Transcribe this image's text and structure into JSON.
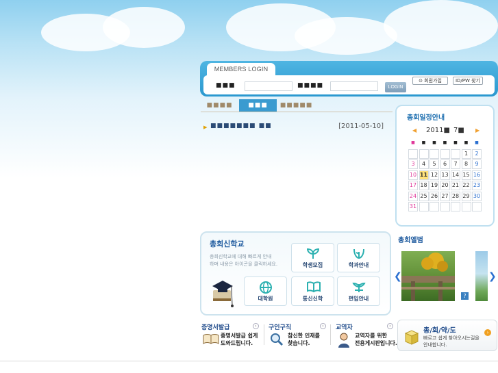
{
  "login": {
    "tab_label": "MEMBERS LOGIN",
    "id_label": "■■■",
    "pw_label": "■■■■",
    "id_value": "",
    "pw_value": "",
    "login_button": "LOGIN",
    "join_button": "회원가입",
    "find_button": "ID/PW 찾기"
  },
  "tabs": [
    {
      "label": "■■■■",
      "active": false
    },
    {
      "label": "■■■",
      "active": true
    },
    {
      "label": "■■■■■",
      "active": false
    }
  ],
  "notice": {
    "title": "■■■■■■■ ■■",
    "date": "[2011-05-10]"
  },
  "calendar": {
    "title": "총회일정안내",
    "year": "2011",
    "year_suffix": "■",
    "month": "7",
    "month_suffix": "■",
    "prev": "◀",
    "next": "▶",
    "weekday_headers": [
      "■",
      "■",
      "■",
      "■",
      "■",
      "■",
      "■"
    ],
    "weeks": [
      [
        "",
        "",
        "",
        "",
        "",
        "1",
        "2"
      ],
      [
        "3",
        "4",
        "5",
        "6",
        "7",
        "8",
        "9"
      ],
      [
        "10",
        "11",
        "12",
        "13",
        "14",
        "15",
        "16"
      ],
      [
        "17",
        "18",
        "19",
        "20",
        "21",
        "22",
        "23"
      ],
      [
        "24",
        "25",
        "26",
        "27",
        "28",
        "29",
        "30"
      ],
      [
        "31",
        "",
        "",
        "",
        "",
        "",
        ""
      ]
    ],
    "today": "11"
  },
  "school": {
    "title": "총회신학교",
    "desc_line1": "총회신학교에 대해 빠르게 안내",
    "desc_line2": "하며 내용은 아이콘을 클릭하세요.",
    "buttons": {
      "recruit": "학생모집",
      "dept": "학과안내",
      "grad": "대학원",
      "correspondence": "통신신학",
      "transfer": "편입안내"
    }
  },
  "album": {
    "title": "총회앨범",
    "help": "?",
    "prev": "❮",
    "next": "❯"
  },
  "quick": {
    "cert": {
      "title": "증명서발급",
      "line1": "증명서발급 쉽게",
      "line2": "도와드립니다."
    },
    "job": {
      "title": "구인구직",
      "line1": "참신한 인재를",
      "line2": "찾습니다."
    },
    "minister": {
      "title": "교역자",
      "line1": "교역자를 위한",
      "line2": "전용게시판입니다."
    },
    "arrow": "›"
  },
  "office": {
    "title": "총/회/약/도",
    "line1": "빠르고 쉽게 찾아오시는길을",
    "line2": "안내합니다.",
    "arrow": "›"
  }
}
